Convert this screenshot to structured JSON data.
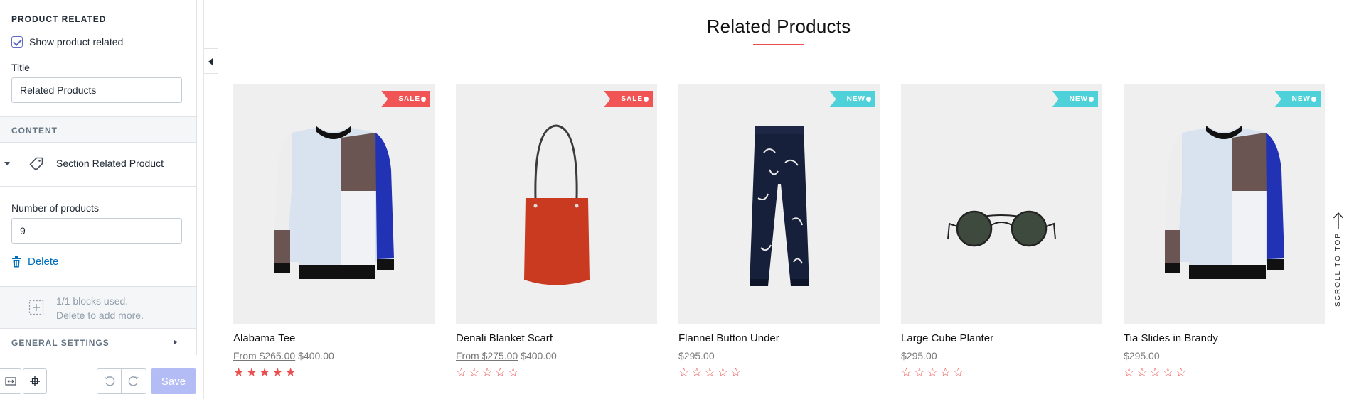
{
  "sidebar": {
    "product_related_heading": "PRODUCT RELATED",
    "show_related_label": "Show product related",
    "show_related_checked": true,
    "title_label": "Title",
    "title_value": "Related Products",
    "content_heading": "CONTENT",
    "block_label": "Section Related Product",
    "num_products_label": "Number of products",
    "num_products_value": "9",
    "delete_label": "Delete",
    "usage_line1": "1/1 blocks used.",
    "usage_line2": "Delete to add more.",
    "general_settings_heading": "GENERAL SETTINGS",
    "save_label": "Save"
  },
  "preview": {
    "section_title": "Related Products",
    "scroll_to_top": "SCROLL TO TOP",
    "products": [
      {
        "name": "Alabama Tee",
        "price_prefix": "From ",
        "price": "$265.00",
        "compare_price": "$400.00",
        "badge": "SALE",
        "rating": 5,
        "image": "sweater"
      },
      {
        "name": "Denali Blanket Scarf",
        "price_prefix": "From ",
        "price": "$275.00",
        "compare_price": "$400.00",
        "badge": "SALE",
        "rating": 0,
        "image": "bag"
      },
      {
        "name": "Flannel Button Under",
        "price_prefix": "",
        "price": "$295.00",
        "compare_price": "",
        "badge": "NEW",
        "rating": 0,
        "image": "pants"
      },
      {
        "name": "Large Cube Planter",
        "price_prefix": "",
        "price": "$295.00",
        "compare_price": "",
        "badge": "NEW",
        "rating": 0,
        "image": "sunglasses"
      },
      {
        "name": "Tia Slides in Brandy",
        "price_prefix": "",
        "price": "$295.00",
        "compare_price": "",
        "badge": "NEW",
        "rating": 0,
        "image": "sweater"
      }
    ]
  },
  "colors": {
    "accent": "#5c6ac4",
    "link": "#006fbb",
    "sale_badge": "#f05454",
    "new_badge": "#4fd1d9",
    "star": "#ec4d4d"
  }
}
